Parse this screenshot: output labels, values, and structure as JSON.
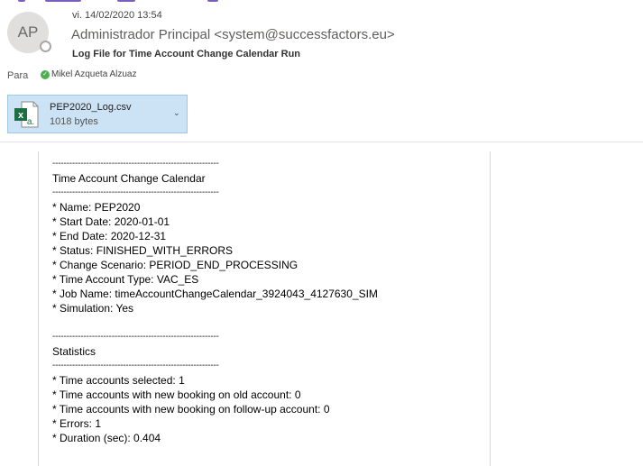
{
  "header": {
    "avatar_initials": "AP",
    "date": "vi. 14/02/2020 13:54",
    "sender": "Administrador Principal <system@successfactors.eu>",
    "subject": "Log File for Time Account Change Calendar Run",
    "to_label": "Para",
    "to_name": "Mikel Azqueta Alzuaz"
  },
  "attachment": {
    "filename": "PEP2020_Log.csv",
    "size": "1018 bytes",
    "icon": "excel-file-icon"
  },
  "body": {
    "lines": [
      "-----------------------------------------------------------",
      "Time Account Change Calendar",
      "-----------------------------------------------------------",
      "* Name: PEP2020",
      "* Start Date: 2020-01-01",
      "* End Date: 2020-12-31",
      "* Status: FINISHED_WITH_ERRORS",
      "* Change Scenario: PERIOD_END_PROCESSING",
      "* Time Account Type: VAC_ES",
      "* Job Name: timeAccountChangeCalendar_3924043_4127630_SIM",
      "* Simulation: Yes",
      "",
      "-----------------------------------------------------------",
      "Statistics",
      "-----------------------------------------------------------",
      "* Time accounts selected: 1",
      "* Time accounts with new booking on old account: 0",
      "* Time accounts with new booking on follow-up account: 0",
      "* Errors: 1",
      "* Duration (sec): 0.404"
    ]
  },
  "colors": {
    "attachment_bg": "#cce3f5",
    "excel_green": "#1d6f42",
    "presence_ok": "#4caf50"
  }
}
